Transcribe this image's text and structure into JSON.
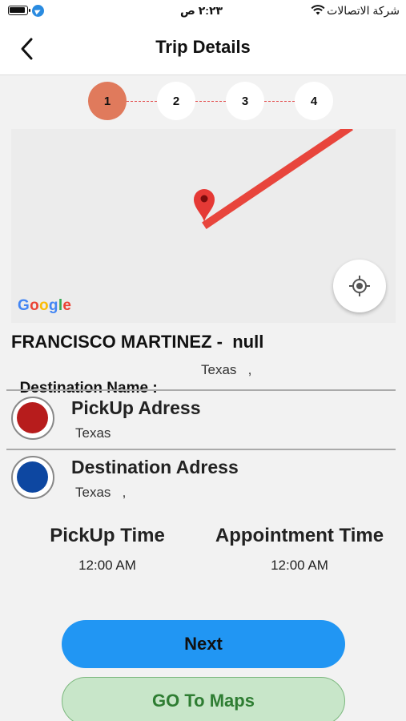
{
  "status_bar": {
    "time": "٢:٢٣ ص",
    "carrier": "شركة الاتصالات",
    "icons": [
      "battery-icon",
      "telegram-icon",
      "wifi-icon"
    ]
  },
  "header": {
    "title": "Trip Details",
    "back_icon": "chevron-left-icon"
  },
  "stepper": {
    "steps": [
      "1",
      "2",
      "3",
      "4"
    ],
    "active_step": 1,
    "active_color": "#e07a5c"
  },
  "map": {
    "logo_text": "Google",
    "route_color": "#e8453c",
    "pin_icon": "map-pin-icon",
    "locate_icon": "my-location-icon"
  },
  "trip": {
    "passenger_line": "FRANCISCO MARTINEZ -  null",
    "destination_name_label": "Destination Name :",
    "destination_name_value": "Texas   ,"
  },
  "pickup": {
    "title": "PickUp Adress",
    "value": "Texas",
    "color": "#b71c1c"
  },
  "destination": {
    "title": "Destination Adress",
    "value": "Texas   ,",
    "color": "#0d47a1"
  },
  "times": {
    "pickup_label": "PickUp Time",
    "pickup_value": "12:00 AM",
    "appointment_label": "Appointment Time",
    "appointment_value": "12:00 AM"
  },
  "buttons": {
    "next": "Next",
    "maps": "GO To Maps"
  }
}
